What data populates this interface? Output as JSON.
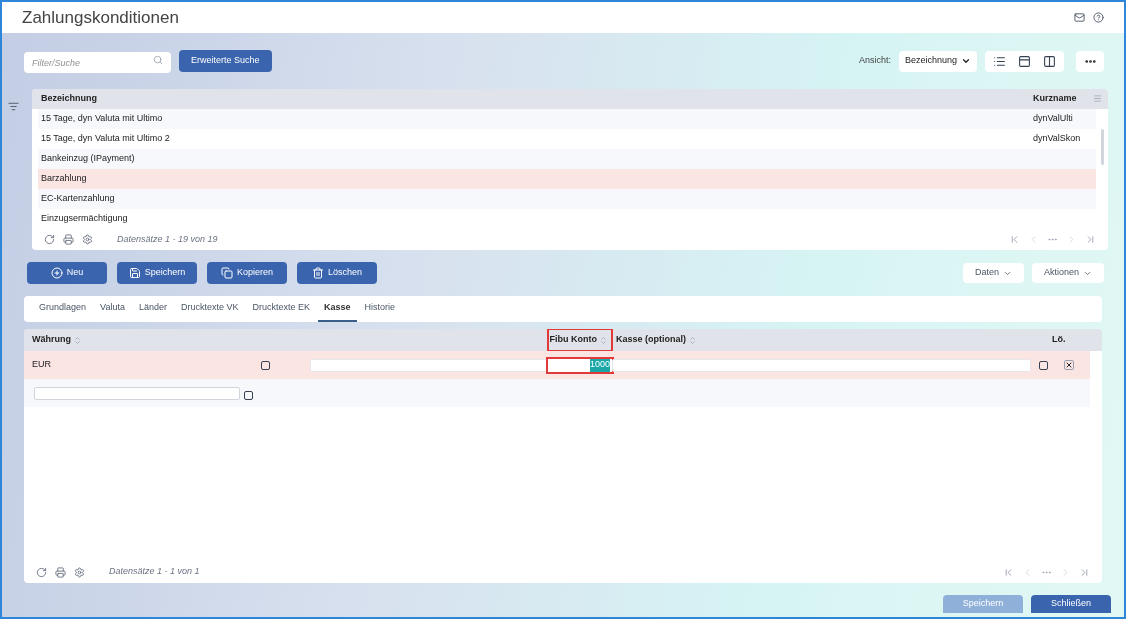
{
  "window": {
    "title": "Zahlungskonditionen"
  },
  "toolbar": {
    "search_placeholder": "Filter/Suche",
    "advanced_search": "Erweiterte Suche",
    "view_label": "Ansicht:",
    "view_select": "Bezeichnung"
  },
  "list": {
    "columns": [
      "Bezeichnung",
      "Kurzname"
    ],
    "rows": [
      {
        "name": "15 Tage, dyn Valuta mit Ultimo",
        "short": "dynValUlti",
        "selected": false
      },
      {
        "name": "15 Tage, dyn Valuta mit Ultimo 2",
        "short": "dynValSkon",
        "selected": false
      },
      {
        "name": "Bankeinzug (IPayment)",
        "short": "",
        "selected": false
      },
      {
        "name": "Barzahlung",
        "short": "",
        "selected": true
      },
      {
        "name": "EC-Kartenzahlung",
        "short": "",
        "selected": false
      },
      {
        "name": "Einzugsermächtigung",
        "short": "",
        "selected": false
      }
    ],
    "footer": "Datensätze 1 - 19 von 19"
  },
  "actions": [
    {
      "label": "Neu",
      "kind": "new"
    },
    {
      "label": "Speichern",
      "kind": "save"
    },
    {
      "label": "Kopieren",
      "kind": "copy"
    },
    {
      "label": "Löschen",
      "kind": "delete"
    }
  ],
  "menus": [
    "Daten",
    "Aktionen"
  ],
  "tabs": [
    {
      "label": "Grundlagen",
      "selected": false
    },
    {
      "label": "Valuta",
      "selected": false
    },
    {
      "label": "Länder",
      "selected": false
    },
    {
      "label": "Drucktexte VK",
      "selected": false
    },
    {
      "label": "Drucktexte EK",
      "selected": false
    },
    {
      "label": "Kasse",
      "selected": true
    },
    {
      "label": "Historie",
      "selected": false
    }
  ],
  "detail": {
    "columns": [
      {
        "label": "Währung",
        "sortable": true,
        "highlighted": false
      },
      {
        "label": "Fibu Konto",
        "sortable": true,
        "highlighted": true
      },
      {
        "label": "Kasse (optional)",
        "sortable": true,
        "highlighted": false
      },
      {
        "label": "Lö.",
        "sortable": false,
        "highlighted": false
      }
    ],
    "rows": [
      {
        "currency": "EUR",
        "fibu": "1000",
        "fibu_text_selected": true,
        "selected": true
      }
    ],
    "footer": "Datensätze 1 - 1 von 1"
  },
  "bottom_buttons": [
    {
      "label": "Speichern",
      "disabled": true
    },
    {
      "label": "Schließen",
      "disabled": false
    }
  ]
}
